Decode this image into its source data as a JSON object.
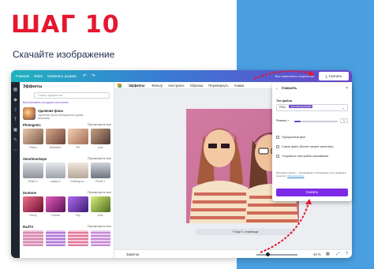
{
  "slide": {
    "step_title": "ШАГ 10",
    "step_subtitle": "Скачайте изображение",
    "accent_color": "#e5172f",
    "panel_color": "#4a9fe0"
  },
  "topbar": {
    "home": "Главная",
    "file": "Файл",
    "resize": "Изменить размер",
    "undo_icon": "undo-icon",
    "redo_icon": "redo-icon",
    "saved_text": "Все изменения сохранены",
    "download_label": "Скачать"
  },
  "effects_panel": {
    "heading": "Эффекты",
    "search_placeholder": "Поиск эффектов",
    "restore_link": "Восстановить исходное состояние",
    "bg_remover": {
      "title": "Удаление фона",
      "description": "Удаление фона изображения одним касанием"
    },
    "sections": [
      {
        "title": "Photogenic",
        "more": "Просмотреть все",
        "items": [
          "Fresco",
          "Belvedere",
          "Pin",
          "Luxe"
        ]
      },
      {
        "title": "Smartmockups",
        "more": "Просмотреть все",
        "items": [
          "Phone 3",
          "Laptop 5",
          "Greeting ca...",
          "Phone 1"
        ]
      },
      {
        "title": "Duotone",
        "more": "Просмотреть все",
        "items": [
          "Cherry",
          "Fuschia",
          "Pop",
          "Lime"
        ]
      },
      {
        "title": "RadTV",
        "more": "Просмотреть все",
        "items": []
      }
    ]
  },
  "toolbar": {
    "effects": "Эффекты",
    "filter": "Фильтр",
    "adjust": "Настроить",
    "crop": "Обрезка",
    "flip": "Перевернуть",
    "animate": "Анима"
  },
  "canvas": {
    "add_page": "+ Еще 1 страница"
  },
  "bottombar": {
    "notes": "Заметки",
    "zoom": "43 %"
  },
  "download_panel": {
    "title": "Скачать",
    "file_type_label": "Тип файла",
    "file_type_value": "PNG",
    "file_type_badge": "РЕКОМЕНДУЕМЫЙ",
    "size_label": "Размер ×",
    "size_value": "1",
    "size_fraction": 0.15,
    "options": [
      "Прозрачный фон",
      "Сжать файл (более низкое качество)",
      "Сохранить настройки скачивания"
    ],
    "note": "Экономьте время — запланируйте публикацию этого дизайна в соцсетях.",
    "note_link": "Запланировать",
    "download_button": "Скачать"
  }
}
